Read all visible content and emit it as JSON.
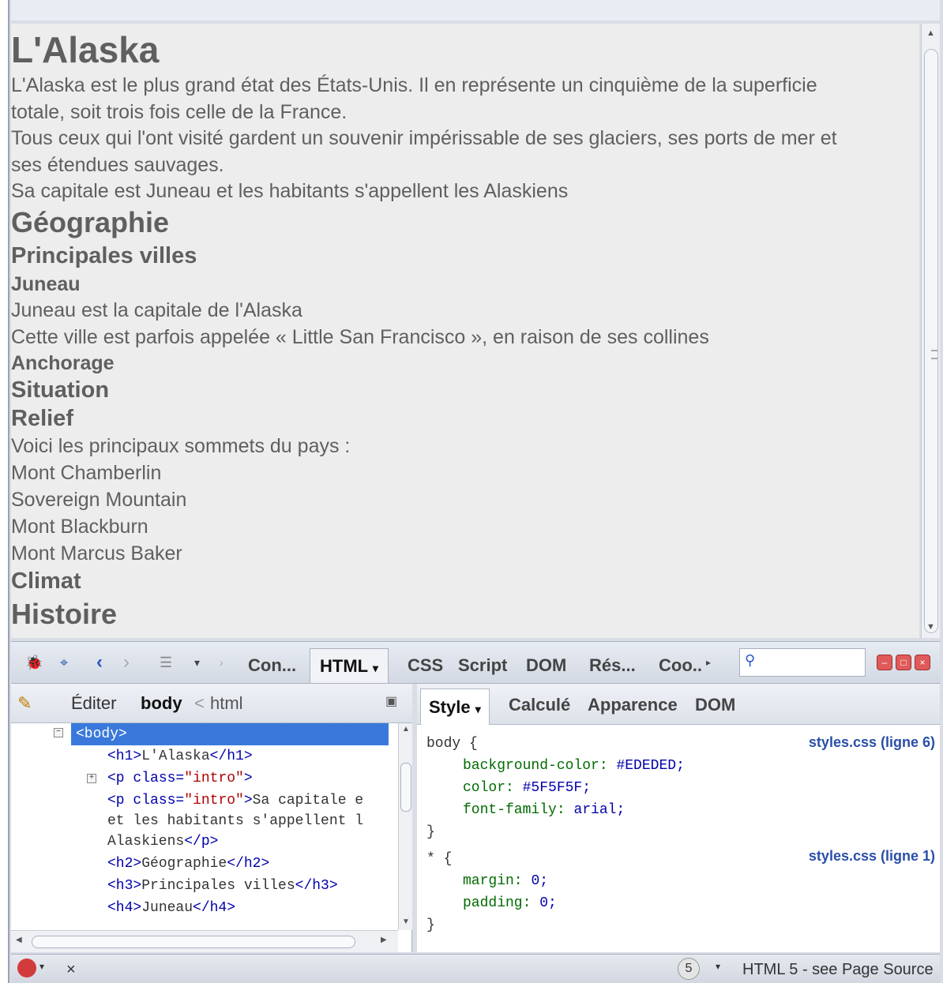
{
  "page": {
    "title": "L'Alaska",
    "intro_lines": [
      "L'Alaska est le plus grand état des États-Unis. Il en représente un cinquième de la superficie",
      "totale, soit trois fois celle de la France.",
      "Tous ceux qui l'ont visité gardent un souvenir impérissable de ses glaciers, ses ports de mer et",
      "ses étendues sauvages.",
      "Sa capitale est Juneau et les habitants s'appellent les Alaskiens"
    ],
    "h2_geographie": "Géographie",
    "h3_villes": "Principales villes",
    "h4_juneau": "Juneau",
    "juneau_p1": "Juneau est la capitale de l'Alaska",
    "juneau_p2": "Cette ville est parfois appelée « Little San Francisco », en raison de ses collines",
    "h4_anchorage": "Anchorage",
    "h3_situation": "Situation",
    "h3_relief": "Relief",
    "relief_intro": "Voici les principaux sommets du pays :",
    "sommets": [
      "Mont Chamberlin",
      "Sovereign Mountain",
      "Mont Blackburn",
      "Mont Marcus Baker"
    ],
    "h3_climat": "Climat",
    "h2_histoire": "Histoire",
    "text_color": "#5F5F5F",
    "background_color": "#EDEDED"
  },
  "firebug": {
    "tabs": {
      "console": "Con...",
      "html": "HTML",
      "css": "CSS",
      "script": "Script",
      "dom": "DOM",
      "reseau": "Rés...",
      "cookies": "Coo.."
    },
    "search_value": "",
    "left": {
      "edit_label": "Éditer",
      "crumb_current": "body",
      "crumb_separator": "<",
      "crumb_parent": "html",
      "tree": {
        "body_open": "<body>",
        "h1_open": "<h1>",
        "h1_text": "L'Alaska",
        "h1_close": "</h1>",
        "p_intro_open_tag": "<p",
        "p_class_attr": "class=",
        "p_class_val": "\"intro\"",
        "p_open_end": ">",
        "p2_text_a": "Sa capitale e",
        "p2_text_b": "et les habitants s'appellent l",
        "p2_text_c": "Alaskiens",
        "p_close": "</p>",
        "h2_open": "<h2>",
        "h2_text": "Géographie",
        "h2_close": "</h2>",
        "h3_open": "<h3>",
        "h3_text": "Principales villes",
        "h3_close": "</h3>",
        "h4_open": "<h4>",
        "h4_text": "Juneau",
        "h4_close": "</h4>"
      }
    },
    "right": {
      "tabs": {
        "style": "Style",
        "calcule": "Calculé",
        "apparence": "Apparence",
        "dom": "DOM"
      },
      "rule1": {
        "selector": "body {",
        "source": "styles.css (ligne 6)",
        "props": [
          {
            "name": "background-color:",
            "value": "#EDEDED;"
          },
          {
            "name": "color:",
            "value": "#5F5F5F;"
          },
          {
            "name": "font-family:",
            "value": "arial;"
          }
        ],
        "close": "}"
      },
      "rule2": {
        "selector": "* {",
        "source": "styles.css (ligne 1)",
        "props": [
          {
            "name": "margin:",
            "value": "0;"
          },
          {
            "name": "padding:",
            "value": "0;"
          }
        ],
        "close": "}"
      }
    },
    "status": {
      "close_symbol": "×",
      "count": "5",
      "doctype": "HTML 5 - see Page Source"
    }
  }
}
